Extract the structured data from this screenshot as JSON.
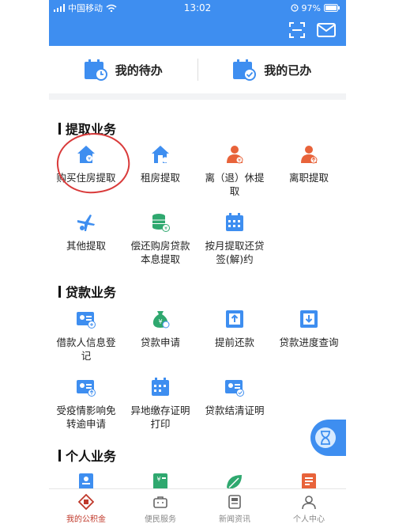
{
  "status": {
    "carrier": "中国移动",
    "time": "13:02",
    "battery": "97%"
  },
  "top_cards": [
    {
      "label": "我的待办",
      "icon": "calendar-clock-icon"
    },
    {
      "label": "我的已办",
      "icon": "calendar-check-icon"
    }
  ],
  "sections": {
    "withdraw": {
      "title": "提取业务",
      "items": [
        {
          "label": "购买住房提取",
          "icon": "house-yen-icon"
        },
        {
          "label": "租房提取",
          "icon": "house-icon"
        },
        {
          "label": "离（退）休提取",
          "icon": "person-yen-icon"
        },
        {
          "label": "离职提取",
          "icon": "person-up-icon"
        },
        {
          "label": "其他提取",
          "icon": "plane-person-icon"
        },
        {
          "label": "偿还购房贷款本息提取",
          "icon": "coins-icon"
        },
        {
          "label": "按月提取还贷签(解)约",
          "icon": "calendar-grid-icon"
        }
      ]
    },
    "loan": {
      "title": "贷款业务",
      "items": [
        {
          "label": "借款人信息登记",
          "icon": "id-card-icon"
        },
        {
          "label": "贷款申请",
          "icon": "money-bag-icon"
        },
        {
          "label": "提前还款",
          "icon": "upload-box-icon"
        },
        {
          "label": "贷款进度查询",
          "icon": "download-box-icon"
        },
        {
          "label": "受疫情影响免转逾申请",
          "icon": "id-card-up-icon"
        },
        {
          "label": "异地缴存证明打印",
          "icon": "calendar-print-icon"
        },
        {
          "label": "贷款结清证明",
          "icon": "id-card-check-icon"
        }
      ]
    },
    "personal": {
      "title": "个人业务",
      "items": [
        {
          "label": "",
          "icon": "person-card-icon"
        },
        {
          "label": "",
          "icon": "yen-doc-icon"
        },
        {
          "label": "",
          "icon": "leaf-icon"
        },
        {
          "label": "",
          "icon": "orange-doc-icon"
        }
      ]
    }
  },
  "tabbar": [
    {
      "label": "我的公积金",
      "active": true
    },
    {
      "label": "便民服务",
      "active": false
    },
    {
      "label": "新闻资讯",
      "active": false
    },
    {
      "label": "个人中心",
      "active": false
    }
  ],
  "colors": {
    "primary": "#3e8ef0",
    "accent_red": "#c0392b",
    "icon_blue": "#3e8ef0",
    "icon_green": "#2fa86f",
    "icon_orange": "#e8633a"
  }
}
